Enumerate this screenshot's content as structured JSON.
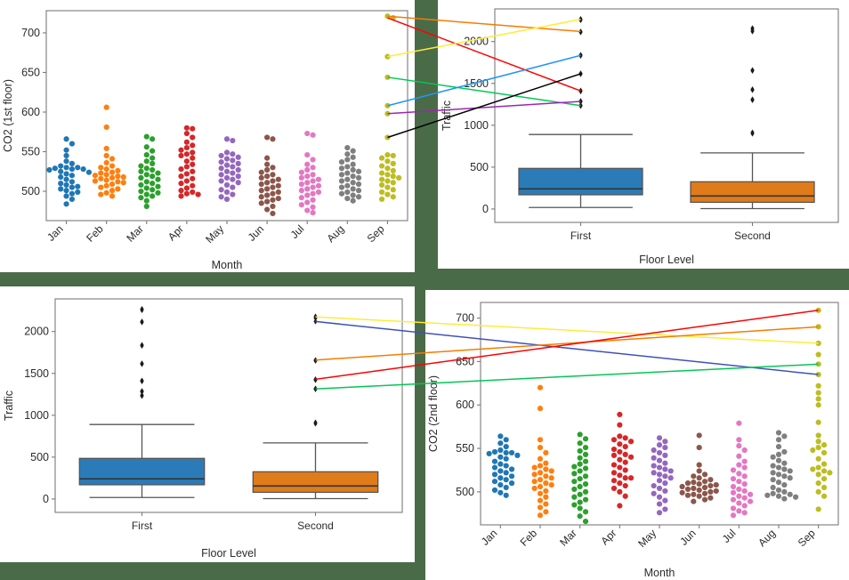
{
  "figure": {
    "background_color": "#4a6b47",
    "panel_background": "#ffffff",
    "layout": "2x2 grid of matplotlib subplots with colored connector lines drawn across panels"
  },
  "palette": {
    "blue": "#1f77b4",
    "orange": "#ff7f0e",
    "green": "#2ca02c",
    "red": "#d62728",
    "purple": "#9467bd",
    "brown": "#8c564b",
    "pink": "#e377c2",
    "gray": "#7f7f7f",
    "olive": "#bcbd22",
    "box_blue": "#2b7bb9",
    "box_orange": "#e07b1a",
    "flier_black": "#1a1a1a"
  },
  "connector_colors": [
    "#ffa726",
    "#ff0000",
    "#ffeb3b",
    "#00c853",
    "#2196f3",
    "#9c27b0",
    "#000000",
    "#f57c00",
    "#3f51b5"
  ],
  "chart_data": [
    {
      "id": "co2-first-floor-swarm",
      "panel": "top-left",
      "type": "scatter",
      "title": "",
      "xlabel": "Month",
      "ylabel": "CO2 (1st floor)",
      "categories": [
        "Jan",
        "Feb",
        "Mar",
        "Apr",
        "May",
        "Jun",
        "Jul",
        "Aug",
        "Sep"
      ],
      "ytick_labels": [
        "500",
        "550",
        "600",
        "650",
        "700"
      ],
      "yticks": [
        500,
        550,
        600,
        650,
        700
      ],
      "ylim": [
        463,
        728
      ],
      "grid": false,
      "legend": "none",
      "xtick_rotation_deg": 45,
      "series": [
        {
          "name": "Jan",
          "color": "#1f77b4",
          "values": [
            566,
            560,
            552,
            545,
            538,
            535,
            532,
            530,
            530,
            529,
            528,
            528,
            527,
            525,
            524,
            522,
            520,
            518,
            515,
            512,
            510,
            508,
            506,
            505,
            503,
            501,
            499,
            497,
            494,
            490,
            484
          ]
        },
        {
          "name": "Feb",
          "color": "#ff7f0e",
          "values": [
            606,
            581,
            554,
            545,
            541,
            536,
            532,
            530,
            528,
            526,
            524,
            523,
            521,
            520,
            519,
            518,
            517,
            516,
            514,
            513,
            512,
            511,
            509,
            507,
            505,
            503,
            501,
            498,
            496,
            494
          ]
        },
        {
          "name": "Mar",
          "color": "#2ca02c",
          "values": [
            569,
            566,
            556,
            551,
            546,
            542,
            538,
            535,
            532,
            529,
            527,
            525,
            523,
            521,
            519,
            517,
            515,
            512,
            510,
            508,
            506,
            504,
            502,
            500,
            498,
            496,
            494,
            492,
            488,
            481
          ]
        },
        {
          "name": "Apr",
          "color": "#d62728",
          "values": [
            580,
            579,
            573,
            568,
            562,
            558,
            555,
            552,
            549,
            547,
            545,
            542,
            538,
            534,
            531,
            528,
            525,
            522,
            519,
            516,
            513,
            510,
            507,
            504,
            501,
            499,
            497,
            496,
            494
          ]
        },
        {
          "name": "May",
          "color": "#9467bd",
          "values": [
            566,
            564,
            549,
            547,
            545,
            543,
            541,
            539,
            537,
            535,
            533,
            531,
            529,
            527,
            525,
            523,
            521,
            519,
            517,
            515,
            513,
            511,
            508,
            505,
            502,
            499,
            496,
            493,
            490
          ]
        },
        {
          "name": "Jun",
          "color": "#8c564b",
          "values": [
            568,
            566,
            542,
            534,
            530,
            527,
            524,
            521,
            519,
            517,
            515,
            513,
            511,
            509,
            507,
            505,
            503,
            501,
            499,
            497,
            495,
            493,
            491,
            489,
            487,
            485,
            481,
            477,
            472
          ]
        },
        {
          "name": "Jul",
          "color": "#e377c2",
          "values": [
            573,
            571,
            546,
            540,
            534,
            530,
            527,
            524,
            521,
            519,
            517,
            515,
            513,
            511,
            509,
            507,
            505,
            503,
            501,
            499,
            497,
            495,
            492,
            489,
            486,
            483,
            480,
            476,
            473
          ]
        },
        {
          "name": "Aug",
          "color": "#7f7f7f",
          "values": [
            555,
            551,
            547,
            543,
            540,
            537,
            534,
            531,
            529,
            527,
            525,
            523,
            521,
            519,
            517,
            515,
            513,
            511,
            509,
            507,
            505,
            503,
            501,
            499,
            497,
            495,
            493,
            491,
            488
          ]
        },
        {
          "name": "Sep",
          "color": "#bcbd22",
          "values": [
            721,
            719,
            670,
            644,
            608,
            598,
            568,
            546,
            545,
            542,
            538,
            535,
            532,
            529,
            526,
            523,
            521,
            519,
            517,
            515,
            513,
            511,
            508,
            505,
            502,
            499,
            496,
            493,
            490
          ]
        }
      ]
    },
    {
      "id": "traffic-floor-level-box-top",
      "panel": "top-right",
      "type": "box",
      "title": "",
      "xlabel": "Floor Level",
      "ylabel": "Traffic",
      "categories": [
        "First",
        "Second"
      ],
      "ytick_labels": [
        "0",
        "500",
        "1000",
        "1500",
        "2000"
      ],
      "yticks": [
        0,
        500,
        1000,
        1500,
        2000
      ],
      "ylim": [
        -160,
        2390
      ],
      "grid": false,
      "legend": "none",
      "boxes": [
        {
          "name": "First",
          "color": "#2b7bb9",
          "whisker_low": 18,
          "q1": 170,
          "median": 240,
          "q3": 485,
          "whisker_high": 890,
          "outliers": [
            2270,
            2255,
            2120,
            2110,
            1840,
            1830,
            1620,
            1610,
            1415,
            1405,
            1290,
            1280,
            1240,
            1230
          ]
        },
        {
          "name": "Second",
          "color": "#e07b1a",
          "whisker_low": 5,
          "q1": 80,
          "median": 155,
          "q3": 325,
          "whisker_high": 670,
          "outliers": [
            2160,
            2140,
            2120,
            1660,
            1650,
            1430,
            1420,
            1310,
            1300,
            915,
            900
          ]
        }
      ]
    },
    {
      "id": "traffic-floor-level-box-bottom",
      "panel": "bottom-left",
      "type": "box",
      "title": "",
      "xlabel": "Floor Level",
      "ylabel": "Traffic",
      "categories": [
        "First",
        "Second"
      ],
      "ytick_labels": [
        "0",
        "500",
        "1000",
        "1500",
        "2000"
      ],
      "yticks": [
        0,
        500,
        1000,
        1500,
        2000
      ],
      "ylim": [
        -160,
        2390
      ],
      "grid": false,
      "legend": "none",
      "boxes": [
        {
          "name": "First",
          "color": "#2b7bb9",
          "whisker_low": 18,
          "q1": 170,
          "median": 240,
          "q3": 485,
          "whisker_high": 890,
          "outliers": [
            2270,
            2255,
            2120,
            2110,
            1840,
            1830,
            1620,
            1610,
            1415,
            1405,
            1290,
            1280,
            1240,
            1230
          ]
        },
        {
          "name": "Second",
          "color": "#e07b1a",
          "whisker_low": 5,
          "q1": 80,
          "median": 155,
          "q3": 325,
          "whisker_high": 670,
          "outliers": [
            2180,
            2160,
            2120,
            1660,
            1650,
            1430,
            1420,
            1320,
            1310,
            915,
            900
          ]
        }
      ]
    },
    {
      "id": "co2-second-floor-swarm",
      "panel": "bottom-right",
      "type": "scatter",
      "title": "",
      "xlabel": "Month",
      "ylabel": "CO2 (2nd floor)",
      "categories": [
        "Jan",
        "Feb",
        "Mar",
        "Apr",
        "May",
        "Jun",
        "Jul",
        "Aug",
        "Sep"
      ],
      "ytick_labels": [
        "500",
        "550",
        "600",
        "650",
        "700"
      ],
      "yticks": [
        500,
        550,
        600,
        650,
        700
      ],
      "ylim": [
        462,
        718
      ],
      "grid": false,
      "legend": "none",
      "xtick_rotation_deg": 45,
      "series": [
        {
          "name": "Jan",
          "color": "#1f77b4",
          "values": [
            564,
            560,
            556,
            552,
            548,
            546,
            545,
            545,
            544,
            542,
            540,
            538,
            535,
            532,
            530,
            528,
            526,
            524,
            522,
            520,
            518,
            516,
            514,
            512,
            510,
            508,
            505,
            502,
            499,
            496
          ]
        },
        {
          "name": "Feb",
          "color": "#ff7f0e",
          "values": [
            620,
            596,
            560,
            551,
            545,
            538,
            533,
            530,
            528,
            526,
            524,
            522,
            520,
            518,
            516,
            514,
            512,
            510,
            508,
            506,
            504,
            501,
            498,
            494,
            490,
            486,
            482,
            477,
            473
          ]
        },
        {
          "name": "Mar",
          "color": "#2ca02c",
          "values": [
            566,
            561,
            556,
            551,
            547,
            543,
            539,
            535,
            532,
            529,
            527,
            524,
            521,
            518,
            515,
            512,
            509,
            506,
            503,
            500,
            497,
            494,
            491,
            488,
            485,
            481,
            477,
            472,
            466
          ]
        },
        {
          "name": "Apr",
          "color": "#d62728",
          "values": [
            589,
            577,
            564,
            562,
            560,
            558,
            555,
            552,
            549,
            546,
            543,
            542,
            540,
            537,
            534,
            531,
            528,
            525,
            522,
            519,
            516,
            516,
            513,
            510,
            507,
            504,
            500,
            495,
            484
          ]
        },
        {
          "name": "May",
          "color": "#9467bd",
          "values": [
            562,
            558,
            554,
            551,
            548,
            545,
            542,
            539,
            536,
            533,
            530,
            528,
            526,
            524,
            522,
            520,
            518,
            516,
            513,
            510,
            507,
            504,
            501,
            498,
            494,
            490,
            486,
            480,
            476
          ]
        },
        {
          "name": "Jun",
          "color": "#8c564b",
          "values": [
            565,
            551,
            531,
            524,
            520,
            518,
            516,
            514,
            512,
            511,
            510,
            509,
            508,
            507,
            506,
            505,
            504,
            503,
            502,
            501,
            500,
            499,
            498,
            497,
            496,
            495,
            493,
            491,
            489
          ]
        },
        {
          "name": "Jul",
          "color": "#e377c2",
          "values": [
            579,
            560,
            553,
            548,
            541,
            535,
            531,
            528,
            525,
            521,
            518,
            515,
            512,
            509,
            506,
            503,
            501,
            499,
            497,
            495,
            493,
            491,
            489,
            487,
            484,
            481,
            478,
            476,
            473
          ]
        },
        {
          "name": "Aug",
          "color": "#7f7f7f",
          "values": [
            568,
            564,
            560,
            552,
            546,
            543,
            540,
            536,
            533,
            530,
            528,
            526,
            524,
            522,
            520,
            518,
            516,
            514,
            511,
            508,
            505,
            502,
            500,
            498,
            497,
            496,
            495,
            494,
            492
          ]
        },
        {
          "name": "Sep",
          "color": "#bcbd22",
          "values": [
            709,
            690,
            671,
            658,
            647,
            635,
            622,
            614,
            607,
            600,
            580,
            565,
            558,
            554,
            551,
            548,
            545,
            538,
            532,
            528,
            526,
            524,
            522,
            520,
            515,
            510,
            505,
            500,
            495,
            480
          ]
        }
      ]
    }
  ],
  "connector_lines": {
    "description": "Colored straight lines linking Sep high values on the CO2 panels to Traffic outliers on the box panels",
    "top_pair": [
      {
        "color": "#f57c00",
        "from_value_co2": 721,
        "to_value_traffic": 2120
      },
      {
        "color": "#ff0000",
        "from_value_co2": 719,
        "to_value_traffic": 1410
      },
      {
        "color": "#ffeb3b",
        "from_value_co2": 670,
        "to_value_traffic": 2265
      },
      {
        "color": "#00c853",
        "from_value_co2": 644,
        "to_value_traffic": 1235
      },
      {
        "color": "#2196f3",
        "from_value_co2": 608,
        "to_value_traffic": 1835
      },
      {
        "color": "#9c27b0",
        "from_value_co2": 598,
        "to_value_traffic": 1285
      },
      {
        "color": "#000000",
        "from_value_co2": 568,
        "to_value_traffic": 1615
      }
    ],
    "bottom_pair": [
      {
        "color": "#ffeb3b",
        "from_value_traffic": 2175,
        "to_value_co2": 671
      },
      {
        "color": "#3f51b5",
        "from_value_traffic": 2120,
        "to_value_co2": 635
      },
      {
        "color": "#f57c00",
        "from_value_traffic": 1660,
        "to_value_co2": 690
      },
      {
        "color": "#ff0000",
        "from_value_traffic": 1430,
        "to_value_co2": 709
      },
      {
        "color": "#00c853",
        "from_value_traffic": 1315,
        "to_value_co2": 647
      }
    ]
  }
}
